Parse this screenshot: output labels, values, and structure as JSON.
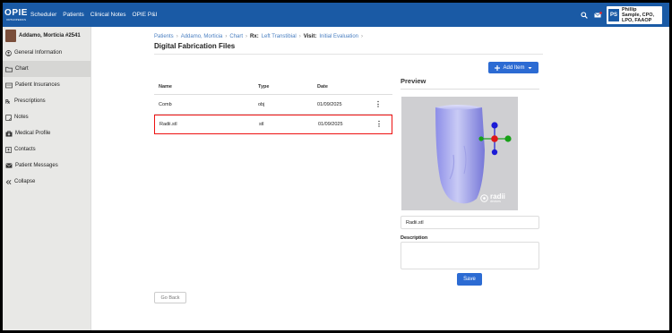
{
  "nav": {
    "logo_main": "OPIE",
    "logo_sub": "ORTHOPEDICS",
    "links": [
      "Scheduler",
      "Patients",
      "Clinical Notes",
      "OPIE P&I"
    ],
    "user_initials": "PS",
    "user_name_line1": "Phillip",
    "user_name_line2": "Sample, CPO,",
    "user_name_line3": "LPO, FAAOP"
  },
  "sidebar": {
    "patient_name": "Addamo, Morticia #2541",
    "items": [
      {
        "label": "General Information",
        "icon": "user-circle-icon"
      },
      {
        "label": "Chart",
        "icon": "folder-icon"
      },
      {
        "label": "Patient Insurances",
        "icon": "card-icon"
      },
      {
        "label": "Prescriptions",
        "icon": "rx-icon"
      },
      {
        "label": "Notes",
        "icon": "note-icon"
      },
      {
        "label": "Medical Profile",
        "icon": "medkit-icon"
      },
      {
        "label": "Contacts",
        "icon": "contacts-icon"
      },
      {
        "label": "Patient Messages",
        "icon": "envelope-icon"
      },
      {
        "label": "Collapse",
        "icon": "chevrons-left-icon"
      }
    ],
    "active_index": 1
  },
  "breadcrumb": {
    "patients": "Patients",
    "patient": "Addamo, Morticia",
    "chart": "Chart",
    "rx_label": "Rx:",
    "rx_value": "Left Transtibial",
    "visit_label": "Visit:",
    "visit_value": "Initial Evaluation"
  },
  "page_title": "Digital Fabrication Files",
  "add_item_label": "Add Item",
  "table": {
    "headers": [
      "Name",
      "Type",
      "Date"
    ],
    "rows": [
      {
        "name": "Comb",
        "type": "obj",
        "date": "01/09/2025"
      },
      {
        "name": "Radii.stl",
        "type": "stl",
        "date": "01/09/2025"
      }
    ],
    "selected_index": 1
  },
  "go_back_label": "Go Back",
  "preview": {
    "title": "Preview",
    "watermark": "radii",
    "watermark_sub": "devices",
    "filename_value": "Radii.stl",
    "description_label": "Description",
    "description_value": "",
    "save_label": "Save"
  },
  "colors": {
    "nav_bg": "#1a5aa5",
    "accent": "#2c6bd3",
    "selected_border": "#e11111"
  }
}
